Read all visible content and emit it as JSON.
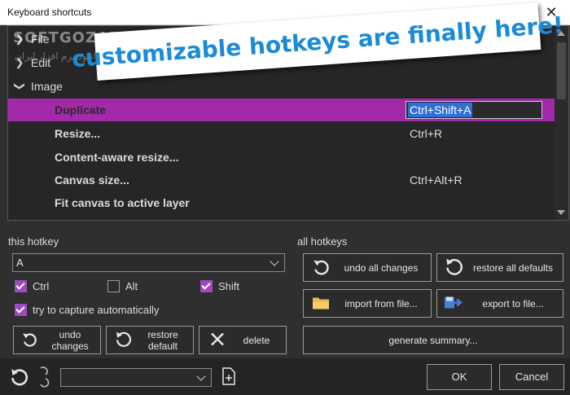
{
  "window": {
    "title": "Keyboard shortcuts"
  },
  "watermark": {
    "brand": "SOFTGOZAR.COM",
    "tagline": "مرجع دانلود نرم افزار ایران"
  },
  "banner": {
    "text": "customizable hotkeys are finally here!",
    "color": "#1b8bd6"
  },
  "tree": {
    "categories": [
      {
        "label": "File",
        "expanded": false
      },
      {
        "label": "Edit",
        "expanded": false
      },
      {
        "label": "Image",
        "expanded": true
      }
    ],
    "commands": [
      {
        "label": "Duplicate",
        "hotkey": "Ctrl+Shift+A",
        "selected": true
      },
      {
        "label": "Resize...",
        "hotkey": "Ctrl+R"
      },
      {
        "label": "Content-aware resize...",
        "hotkey": ""
      },
      {
        "label": "Canvas size...",
        "hotkey": "Ctrl+Alt+R"
      },
      {
        "label": "Fit canvas to active layer",
        "hotkey": ""
      }
    ],
    "selection_color": "#a22aa9"
  },
  "this_hotkey": {
    "heading": "this hotkey",
    "key_value": "A",
    "ctrl": {
      "label": "Ctrl",
      "checked": true
    },
    "alt": {
      "label": "Alt",
      "checked": false
    },
    "shift": {
      "label": "Shift",
      "checked": true
    },
    "auto_capture": {
      "label": "try to capture automatically",
      "checked": true
    },
    "undo_label": "undo changes",
    "restore_label": "restore default",
    "delete_label": "delete"
  },
  "all_hotkeys": {
    "heading": "all hotkeys",
    "undo_all_label": "undo all changes",
    "restore_all_label": "restore all defaults",
    "import_label": "import from file...",
    "export_label": "export to file...",
    "summary_label": "generate summary..."
  },
  "footer": {
    "preset_value": "",
    "ok_label": "OK",
    "cancel_label": "Cancel"
  },
  "icons": [
    "close-icon",
    "chevron-right-icon",
    "chevron-down-icon",
    "undo-icon",
    "restore-icon",
    "delete-x-icon",
    "folder-icon",
    "export-icon",
    "new-file-icon",
    "redo-icon"
  ]
}
